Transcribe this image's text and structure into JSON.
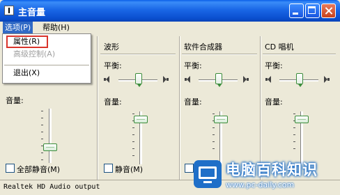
{
  "window": {
    "title": "主音量"
  },
  "menu": [
    {
      "label": "选项(P)"
    },
    {
      "label": "帮助(H)"
    }
  ],
  "options_menu": {
    "items": [
      {
        "label": "属性(R)",
        "enabled": true,
        "highlighted": true
      },
      {
        "label": "高级控制(A)",
        "enabled": false
      },
      {
        "label": "退出(X)",
        "enabled": true
      }
    ]
  },
  "master": {
    "volume_label": "音量:",
    "mute_label": "全部静音(M)",
    "volume": 0.25,
    "balance": 0.5
  },
  "channels": [
    {
      "name": "波形",
      "balance_label": "平衡:",
      "volume_label": "音量:",
      "mute_label": "静音(M)",
      "volume": 0.85,
      "balance": 0.5
    },
    {
      "name": "软件合成器",
      "balance_label": "平衡:",
      "volume_label": "音量:",
      "mute_label": "",
      "volume": 0.85,
      "balance": 0.5
    },
    {
      "name": "CD 唱机",
      "balance_label": "平衡:",
      "volume_label": "音量:",
      "mute_label": "",
      "volume": 0.85,
      "balance": 0.5
    }
  ],
  "status": {
    "device": "Realtek HD Audio output"
  },
  "watermark": {
    "title": "电脑百科知识",
    "url": "www.pc-daily.com"
  },
  "colors": {
    "titlebar": "#0A5FE8",
    "menu_highlight": "#316AC5",
    "highlight_box": "#D9342B",
    "watermark": "#1F6FC8"
  }
}
